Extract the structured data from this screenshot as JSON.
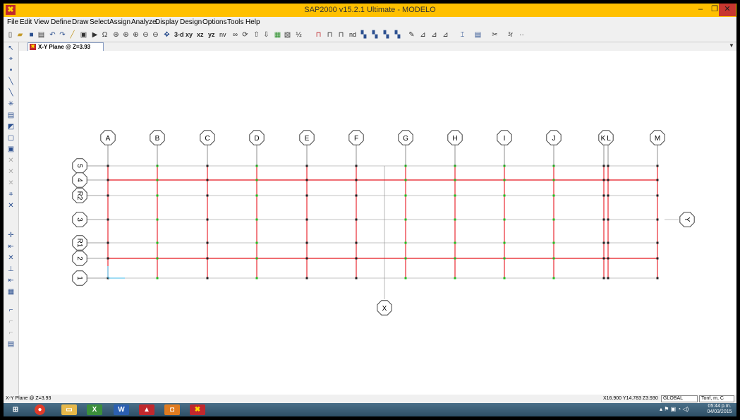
{
  "window": {
    "title": "SAP2000 v15.2.1 Ultimate  - MODELO",
    "min_label": "–",
    "max_label": "❐",
    "close_label": "✕"
  },
  "menu": [
    "File",
    "Edit",
    "View",
    "Define",
    "Draw",
    "Select",
    "Assign",
    "Analyze",
    "Display",
    "Design",
    "Options",
    "Tools",
    "Help"
  ],
  "toolbar": {
    "view_labels": [
      "3-d",
      "xy",
      "xz",
      "yz",
      "nv"
    ],
    "nd_label": "nd"
  },
  "tab": {
    "label": "X-Y Plane @ Z=3.93"
  },
  "grid": {
    "columns": [
      "A",
      "B",
      "C",
      "D",
      "E",
      "F",
      "G",
      "H",
      "I",
      "J",
      "K",
      "L",
      "M"
    ],
    "rows": [
      "5",
      "4",
      "R2",
      "3",
      "R1",
      "2",
      "1"
    ],
    "x_axis_label": "X",
    "y_axis_label": "Y"
  },
  "status": {
    "view": "X-Y Plane @ Z=3.93",
    "coords": "X16.900  Y14.783  Z3.930",
    "coord_system": "GLOBAL",
    "units": "Tonf, m, C"
  },
  "taskbar": {
    "time": "05:44 p.m.",
    "date": "04/03/2015"
  },
  "colors": {
    "title_bar": "#ffc000",
    "beam": "#e8161e",
    "joint_green": "#20c020",
    "grid_line": "#888888"
  }
}
